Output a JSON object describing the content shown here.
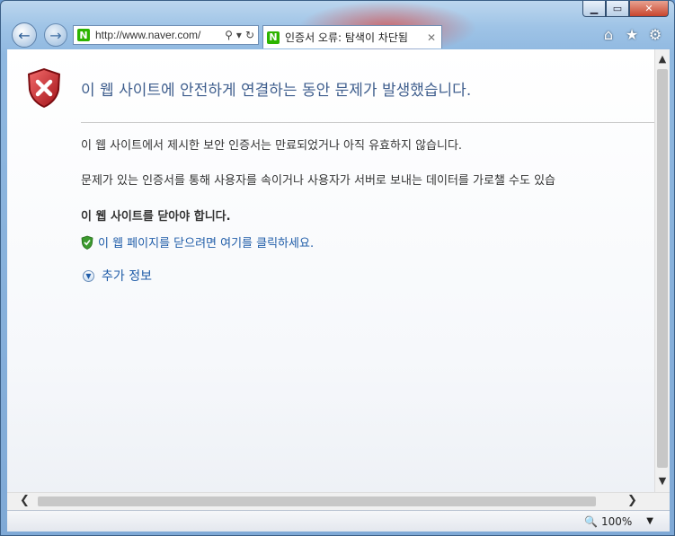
{
  "browser": {
    "address": "http://www.naver.com/",
    "favicon_letter": "N",
    "tab_title": "인증서 오류: 탐색이 차단됨",
    "zoom": "100%"
  },
  "page": {
    "heading": "이 웹 사이트에 안전하게 연결하는 동안 문제가 발생했습니다.",
    "para1": "이 웹 사이트에서 제시한 보안 인증서는 만료되었거나 아직 유효하지 않습니다.",
    "para2": "문제가 있는 인증서를 통해 사용자를 속이거나 사용자가 서버로 보내는 데이터를 가로챌 수도 있습",
    "recommend": "이 웹 사이트를 닫아야 합니다.",
    "close_link": "이 웹 페이지를 닫으려면 여기를 클릭하세요.",
    "more_info": "추가 정보"
  },
  "colors": {
    "heading": "#3f5e8d",
    "link": "#1f5ca8",
    "shield_red": "#c8262a"
  }
}
